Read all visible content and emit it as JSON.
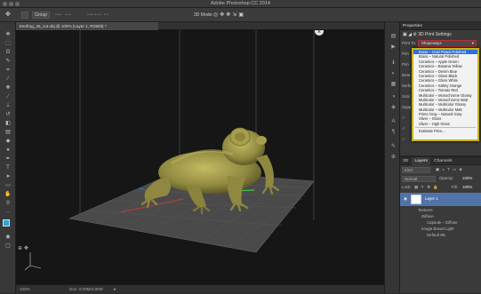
{
  "app": {
    "title": "Adobe Photoshop CC 2014"
  },
  "options": {
    "group_label": "Group",
    "mode_label": "3D Mode:"
  },
  "document": {
    "tab_label": "treefrog_45_cut.obj @ 100% (Layer 1, RGB/8) *",
    "zoom": "100%",
    "doc_size": "Doc: 0.00M/4.00M"
  },
  "properties": {
    "panel_title": "Properties",
    "section_title": "3D Print Settings",
    "print_to_label": "Print To:",
    "print_to_value": "Shapeways",
    "materials": [
      "Brass – Gold Plated Polished",
      "Brass – Natural Polished",
      "Ceramics – Apple Green",
      "Ceramics – Banana Yellow",
      "Ceramics – Denim Blue",
      "Ceramics – Gloss Black",
      "Ceramics – Gloss White",
      "Ceramics – Safety Orange",
      "Ceramics – Tomato Red",
      "Multicolor – Monochrome Glossy",
      "Multicolor – Monochrome Matt",
      "Multicolor – Multicolor Glossy",
      "Multicolor – Multicolor Matt",
      "Prime Gray – Natural Gray",
      "Silver – Gloss",
      "Silver – High Gloss"
    ],
    "estimate_label": "Estimate Price..."
  },
  "layers": {
    "tabs": [
      "3D",
      "Layers",
      "Channels"
    ],
    "kind_label": "Kind",
    "blend_mode": "Normal",
    "opacity_label": "Opacity:",
    "opacity_value": "100%",
    "lock_label": "Lock:",
    "fill_label": "Fill:",
    "fill_value": "100%",
    "layer_name": "Layer 1",
    "sub_items": [
      "Textures",
      "Diffuse",
      "Capsule – Diffuse",
      "Image Based Light",
      "Default IBL"
    ]
  },
  "colors": {
    "accent_selection": "#2f6fd6",
    "highlight_border": "#c8b21a",
    "frog": "#9a9244"
  }
}
